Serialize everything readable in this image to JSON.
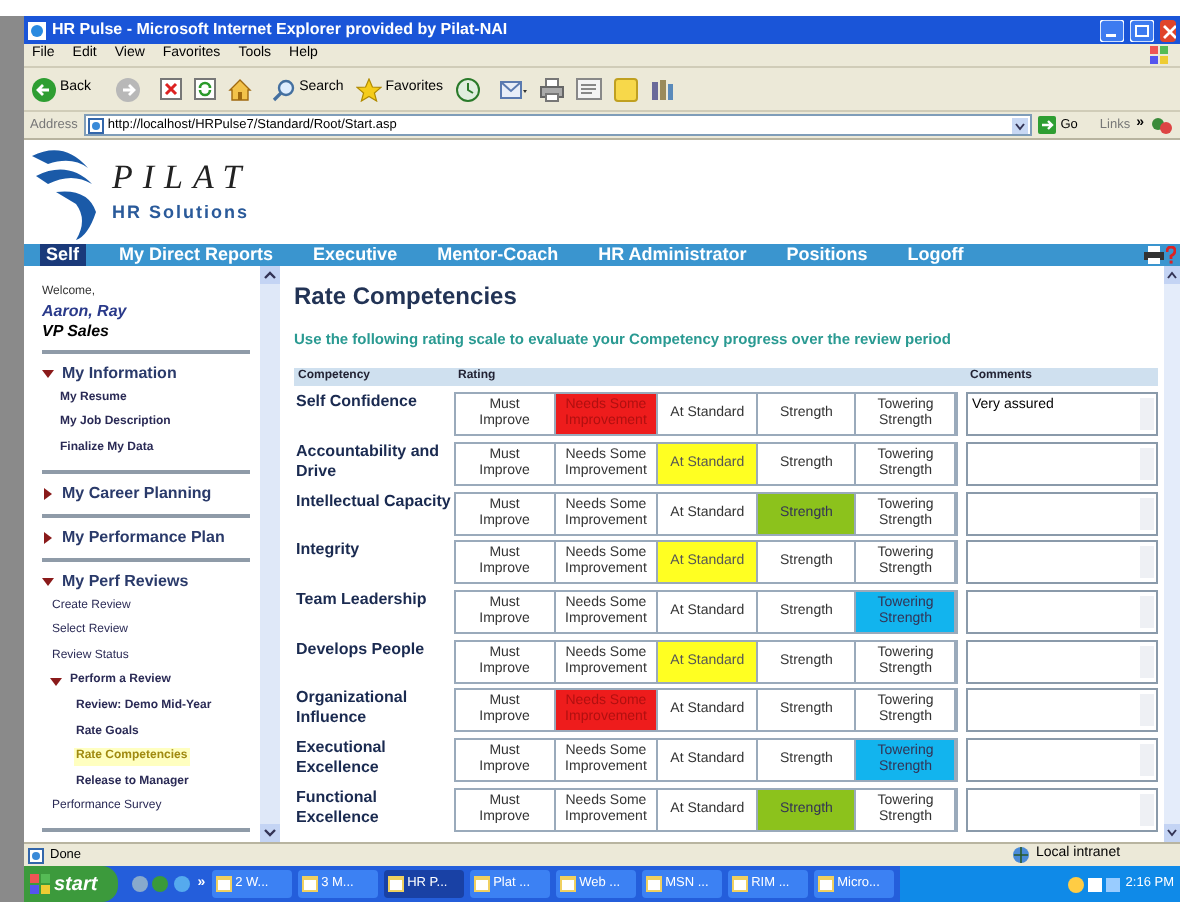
{
  "window": {
    "title": "HR Pulse - Microsoft Internet Explorer provided by Pilat-NAI"
  },
  "menu": [
    "File",
    "Edit",
    "View",
    "Favorites",
    "Tools",
    "Help"
  ],
  "toolbar": {
    "back": "Back",
    "search": "Search",
    "favorites": "Favorites"
  },
  "address_bar": {
    "label": "Address",
    "url": "http://localhost/HRPulse7/Standard/Root/Start.asp",
    "go": "Go",
    "links": "Links",
    "more": "»"
  },
  "logo": {
    "name": "PILAT",
    "tagline": "HR Solutions"
  },
  "nav": [
    {
      "label": "Self",
      "selected": true
    },
    {
      "label": "My Direct Reports",
      "selected": false
    },
    {
      "label": "Executive",
      "selected": false
    },
    {
      "label": "Mentor-Coach",
      "selected": false
    },
    {
      "label": "HR Administrator",
      "selected": false
    },
    {
      "label": "Positions",
      "selected": false
    },
    {
      "label": "Logoff",
      "selected": false
    }
  ],
  "sidebar": {
    "welcome": "Welcome,",
    "user": "Aaron, Ray",
    "role": "VP Sales",
    "sections": [
      {
        "label": "My Information",
        "expanded": true,
        "children": [
          {
            "label": "My Resume",
            "selected": false
          },
          {
            "label": "My Job Description",
            "selected": false
          },
          {
            "label": "Finalize My Data",
            "selected": false
          }
        ]
      },
      {
        "label": "My Career Planning",
        "expanded": false
      },
      {
        "label": "My Performance Plan",
        "expanded": false
      },
      {
        "label": "My Perf Reviews",
        "expanded": true,
        "children": [
          {
            "label": "Create Review",
            "selected": false
          },
          {
            "label": "Select Review",
            "selected": false
          },
          {
            "label": "Review Status",
            "selected": false
          },
          {
            "label": "Perform a Review",
            "selected": false,
            "expanded": true,
            "children": [
              {
                "label": "Review: Demo Mid-Year",
                "selected": false
              },
              {
                "label": "Rate Goals",
                "selected": false
              },
              {
                "label": "Rate Competencies",
                "selected": true
              },
              {
                "label": "Release to Manager",
                "selected": false
              }
            ]
          },
          {
            "label": "Performance Survey",
            "selected": false
          }
        ]
      }
    ]
  },
  "page": {
    "title": "Rate Competencies",
    "instruction": "Use the following rating scale to evaluate your Competency progress over the review period"
  },
  "table": {
    "columns": [
      "Competency",
      "Rating",
      "Comments"
    ],
    "rows": [
      {
        "competency": "Self Confidence",
        "comment": "Very assured",
        "options": [
          {
            "label": "Must Improve",
            "selected": false
          },
          {
            "label": "Needs Some Improvement",
            "selected": true
          },
          {
            "label": "At Standard",
            "selected": false
          },
          {
            "label": "Strength",
            "selected": false
          },
          {
            "label": "Towering Strength",
            "selected": false
          }
        ]
      },
      {
        "competency": "Accountability and Drive",
        "options": [
          {
            "label": "Must Improve",
            "selected": false
          },
          {
            "label": "Needs Some Improvement",
            "selected": false
          },
          {
            "label": "At Standard",
            "selected": true
          },
          {
            "label": "Strength",
            "selected": false
          },
          {
            "label": "Towering Strength",
            "selected": false
          }
        ]
      },
      {
        "competency": "Intellectual Capacity",
        "options": [
          {
            "label": "Must Improve",
            "selected": false
          },
          {
            "label": "Needs Some Improvement",
            "selected": false
          },
          {
            "label": "At Standard",
            "selected": false
          },
          {
            "label": "Strength",
            "selected": true
          },
          {
            "label": "Towering Strength",
            "selected": false
          }
        ]
      },
      {
        "competency": "Integrity",
        "options": [
          {
            "label": "Must Improve",
            "selected": false
          },
          {
            "label": "Needs Some Improvement",
            "selected": false
          },
          {
            "label": "At Standard",
            "selected": true
          },
          {
            "label": "Strength",
            "selected": false
          },
          {
            "label": "Towering Strength",
            "selected": false
          }
        ]
      },
      {
        "competency": "Team Leadership",
        "options": [
          {
            "label": "Must Improve",
            "selected": false
          },
          {
            "label": "Needs Some Improvement",
            "selected": false
          },
          {
            "label": "At Standard",
            "selected": false
          },
          {
            "label": "Strength",
            "selected": false
          },
          {
            "label": "Towering Strength",
            "selected": true
          }
        ]
      },
      {
        "competency": "Develops People",
        "options": [
          {
            "label": "Must Improve",
            "selected": false
          },
          {
            "label": "Needs Some Improvement",
            "selected": false
          },
          {
            "label": "At Standard",
            "selected": true
          },
          {
            "label": "Strength",
            "selected": false
          },
          {
            "label": "Towering Strength",
            "selected": false
          }
        ]
      },
      {
        "competency": "Organizational Influence",
        "options": [
          {
            "label": "Must Improve",
            "selected": false
          },
          {
            "label": "Needs Some Improvement",
            "selected": true
          },
          {
            "label": "At Standard",
            "selected": false
          },
          {
            "label": "Strength",
            "selected": false
          },
          {
            "label": "Towering Strength",
            "selected": false
          }
        ]
      },
      {
        "competency": "Executional Excellence",
        "options": [
          {
            "label": "Must Improve",
            "selected": false
          },
          {
            "label": "Needs Some Improvement",
            "selected": false
          },
          {
            "label": "At Standard",
            "selected": false
          },
          {
            "label": "Strength",
            "selected": false
          },
          {
            "label": "Towering Strength",
            "selected": true
          }
        ]
      },
      {
        "competency": "Functional Excellence",
        "options": [
          {
            "label": "Must Improve",
            "selected": false
          },
          {
            "label": "Needs Some Improvement",
            "selected": false
          },
          {
            "label": "At Standard",
            "selected": false
          },
          {
            "label": "Strength",
            "selected": true
          },
          {
            "label": "Towering Strength",
            "selected": false
          }
        ]
      }
    ]
  },
  "status_bar": {
    "text": "Done",
    "zone": "Local intranet"
  },
  "taskbar": {
    "start": "start",
    "more": "»",
    "items": [
      {
        "label": "2 W...",
        "selected": false
      },
      {
        "label": "3 M...",
        "selected": false
      },
      {
        "label": "HR P...",
        "selected": true
      },
      {
        "label": "Plat ...",
        "selected": false
      },
      {
        "label": "Web ...",
        "selected": false
      },
      {
        "label": "MSN ...",
        "selected": false
      },
      {
        "label": "RIM ...",
        "selected": false
      },
      {
        "label": "Micro...",
        "selected": false
      }
    ],
    "clock": "2:16 PM"
  }
}
